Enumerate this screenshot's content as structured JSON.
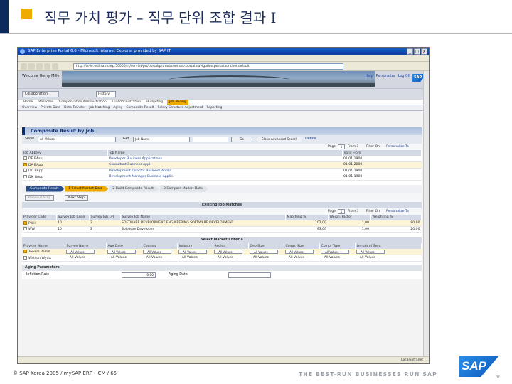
{
  "slide": {
    "title": "직무 가치 평가 – 직무 단위 조합 결과 I",
    "footer_copyright": "© SAP Korea 2005 / mySAP ERP HCM / 65",
    "tagline": "THE BEST-RUN BUSINESSES RUN SAP",
    "logo_text": "SAP",
    "registered": "®",
    "colors": {
      "title_text": "#1d2c58",
      "accent_square": "#f0ab00",
      "sap_blue": "#0b56ba"
    }
  },
  "browser": {
    "window_title": "SAP Enterprise Portal 6.0 - Microsoft Internet Explorer provided by SAP IT",
    "address": "http://ts-hr.wdf.sap.corp:50000/irj/servlet/prt/portal/prtroot/com.sap.portal.navigation.portallauncher.default",
    "controls": [
      "_",
      "□",
      "x"
    ],
    "status_zone": "Local intranet"
  },
  "portal": {
    "welcome": "Welcome Henry Miller",
    "header_links": [
      "Help",
      "Personalize",
      "Log Off"
    ],
    "logo_text": "SAP",
    "collab_button": "Collaboration",
    "collab_select": "History",
    "nav_level1": [
      {
        "label": "Home",
        "active": false
      },
      {
        "label": "Welcome",
        "active": false
      },
      {
        "label": "Compensation Administration",
        "active": false
      },
      {
        "label": "LTI Administration",
        "active": false
      },
      {
        "label": "Budgeting",
        "active": false
      },
      {
        "label": "Job Pricing",
        "active": true
      }
    ],
    "nav_level2": [
      "Overview",
      "Private Data",
      "Data Transfer",
      "Job Matching",
      "Aging",
      "Composite Result",
      "Salary Structure Adjustment",
      "Reporting"
    ]
  },
  "composite": {
    "title": "Composite Result by Job",
    "show_label": "Show",
    "show_value": "All Values",
    "get_label": "Get",
    "get_value": "Job Name",
    "go": "Go",
    "advanced_search": "Close Advanced Search",
    "define": "Define",
    "page_label": "Page",
    "page_value": "1",
    "of_label": "From 1",
    "filter_on": "Filter On",
    "personalize": "Personalize Ta",
    "columns": [
      "Job Abbrev",
      "Job Name",
      "Valid From"
    ],
    "rows": [
      {
        "abbrev": "DE BAsp",
        "name": "Developer Business Applications",
        "valid": "01.01.1900",
        "selected": false
      },
      {
        "abbrev": "DA BApp",
        "name": "Consultant Business Appl.",
        "valid": "01.01.2000",
        "selected": true
      },
      {
        "abbrev": "DD BApp",
        "name": "Development Director Business Applic.",
        "valid": "01.01.1900",
        "selected": false
      },
      {
        "abbrev": "DM BApp",
        "name": "Development Manager Business Applic.",
        "valid": "01.01.1900",
        "selected": false
      }
    ]
  },
  "roadmap": {
    "steps": [
      {
        "label": "Composite Result",
        "state": "done"
      },
      {
        "label": "1 Select Market Data",
        "state": "active"
      },
      {
        "label": "2 Build Composite Result",
        "state": "todo"
      },
      {
        "label": "3 Compare Market Data",
        "state": "todo"
      }
    ],
    "previous": "Previous Step",
    "next": "Next Step"
  },
  "job_matches": {
    "title": "Existing Job Matches",
    "page_value": "1",
    "page_label": "Page",
    "of_label": "From 1",
    "filter_on": "Filter On",
    "personalize": "Personalize Ta",
    "columns": [
      "Provider Code",
      "Survey Job Code",
      "Survey Job Lvl",
      "Survey Job Name",
      "Matching %",
      "Weigh. Factor",
      "Weighting %"
    ],
    "rows": [
      {
        "provider": "PWH",
        "code": "10",
        "lvl": "2",
        "name": "SOFTWARE DEVELOPMENT ENGINEERING SOFTWARE DEVELOPMENT",
        "match": "107,00",
        "factor": "1,00",
        "weight": "80,00",
        "selected": true
      },
      {
        "provider": "WW",
        "code": "10",
        "lvl": "2",
        "name": "Software Developer",
        "match": "93,00",
        "factor": "1,00",
        "weight": "20,00",
        "selected": false
      }
    ]
  },
  "market_criteria": {
    "title": "Select Market Criteria",
    "columns": [
      "Provider Name",
      "Survey Name",
      "Age Date",
      "Country",
      "Industry",
      "Region",
      "Geo Size",
      "Comp. Size",
      "Comp. Type",
      "Length of Serv."
    ],
    "rows": [
      {
        "provider": "Towers Perrin",
        "survey": "-- All Values --",
        "age": "-- All Values --",
        "country": "-- All Values --",
        "industry": "-- All Values --",
        "region": "-- All Values --",
        "geo": "-- All Values --",
        "comp_size": "-- All Values --",
        "comp_type": "-- All Values --",
        "los": "-- All Values --",
        "selected": true
      },
      {
        "provider": "Watson Wyatt",
        "survey": "-- All Values --",
        "age": "-- All Values --",
        "country": "-- All Values --",
        "industry": "-- All Values --",
        "region": "-- All Values --",
        "geo": "-- All Values --",
        "comp_size": "-- All Values --",
        "comp_type": "-- All Values --",
        "los": "-- All Values --",
        "selected": false
      }
    ]
  },
  "aging": {
    "title": "Aging Parameters",
    "rate_label": "Inflation Rate",
    "rate_value": "0,00",
    "date_label": "Aging Date"
  }
}
